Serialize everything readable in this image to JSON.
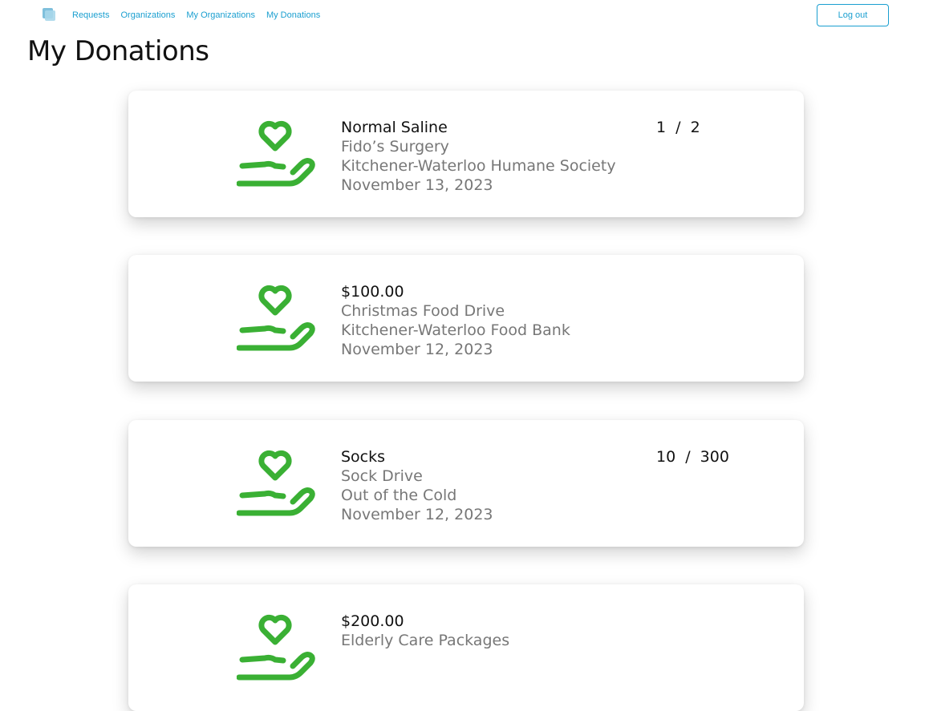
{
  "nav": {
    "links": [
      "Requests",
      "Organizations",
      "My Organizations",
      "My Donations"
    ],
    "logout_label": "Log out"
  },
  "page": {
    "title": "My Donations"
  },
  "accent_color": "#3ab034",
  "link_color": "#1a9fd0",
  "donations": [
    {
      "item": "Normal Saline",
      "campaign": "Fido’s Surgery",
      "organization": "Kitchener-Waterloo Humane Society",
      "date": "November 13, 2023",
      "progress": "1 / 2"
    },
    {
      "item": "$100.00",
      "campaign": "Christmas Food Drive",
      "organization": "Kitchener-Waterloo Food Bank",
      "date": "November 12, 2023",
      "progress": ""
    },
    {
      "item": "Socks",
      "campaign": "Sock Drive",
      "organization": "Out of the Cold",
      "date": "November 12, 2023",
      "progress": "10 / 300"
    },
    {
      "item": "$200.00",
      "campaign": "Elderly Care Packages",
      "organization": "",
      "date": "",
      "progress": ""
    }
  ]
}
